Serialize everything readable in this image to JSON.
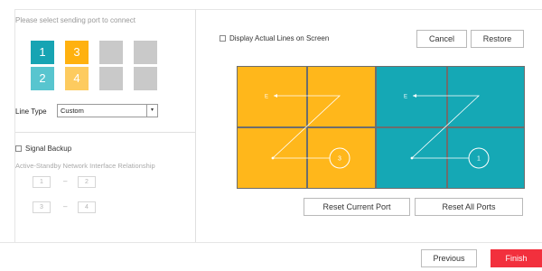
{
  "left_panel": {
    "port_hint": "Please select sending port to connect",
    "ports": [
      {
        "label": "1",
        "color": "#17a4b3"
      },
      {
        "label": "3",
        "color": "#ffb10f"
      },
      {
        "label": "2",
        "color": "#58c5cf"
      },
      {
        "label": "4",
        "color": "#fdcb5f"
      }
    ],
    "empty_port_color": "#c9c9c9",
    "line_type_label": "Line Type",
    "line_type_value": "Custom",
    "line_type_arrow": "▾",
    "signal_backup_label": "Signal Backup",
    "asni_label": "Active-Standby Network Interface Relationship",
    "pairs": [
      {
        "left": "1",
        "dash": "–",
        "right": "2"
      },
      {
        "left": "3",
        "dash": "–",
        "right": "4"
      }
    ]
  },
  "right_panel": {
    "display_lines_label": "Display Actual Lines on Screen",
    "cancel_label": "Cancel",
    "restore_label": "Restore",
    "canvas": {
      "left_group_color": "#ffb71b",
      "right_group_color": "#15a8b5",
      "grid_line_color": "#6d6d6d",
      "left_group": {
        "start_badge": "3",
        "end_label": "E"
      },
      "right_group": {
        "start_badge": "1",
        "end_label": "E"
      }
    },
    "reset_current_label": "Reset Current Port",
    "reset_all_label": "Reset All Ports"
  },
  "footer": {
    "previous_label": "Previous",
    "finish_label": "Finish",
    "finish_color": "#f2303d"
  }
}
